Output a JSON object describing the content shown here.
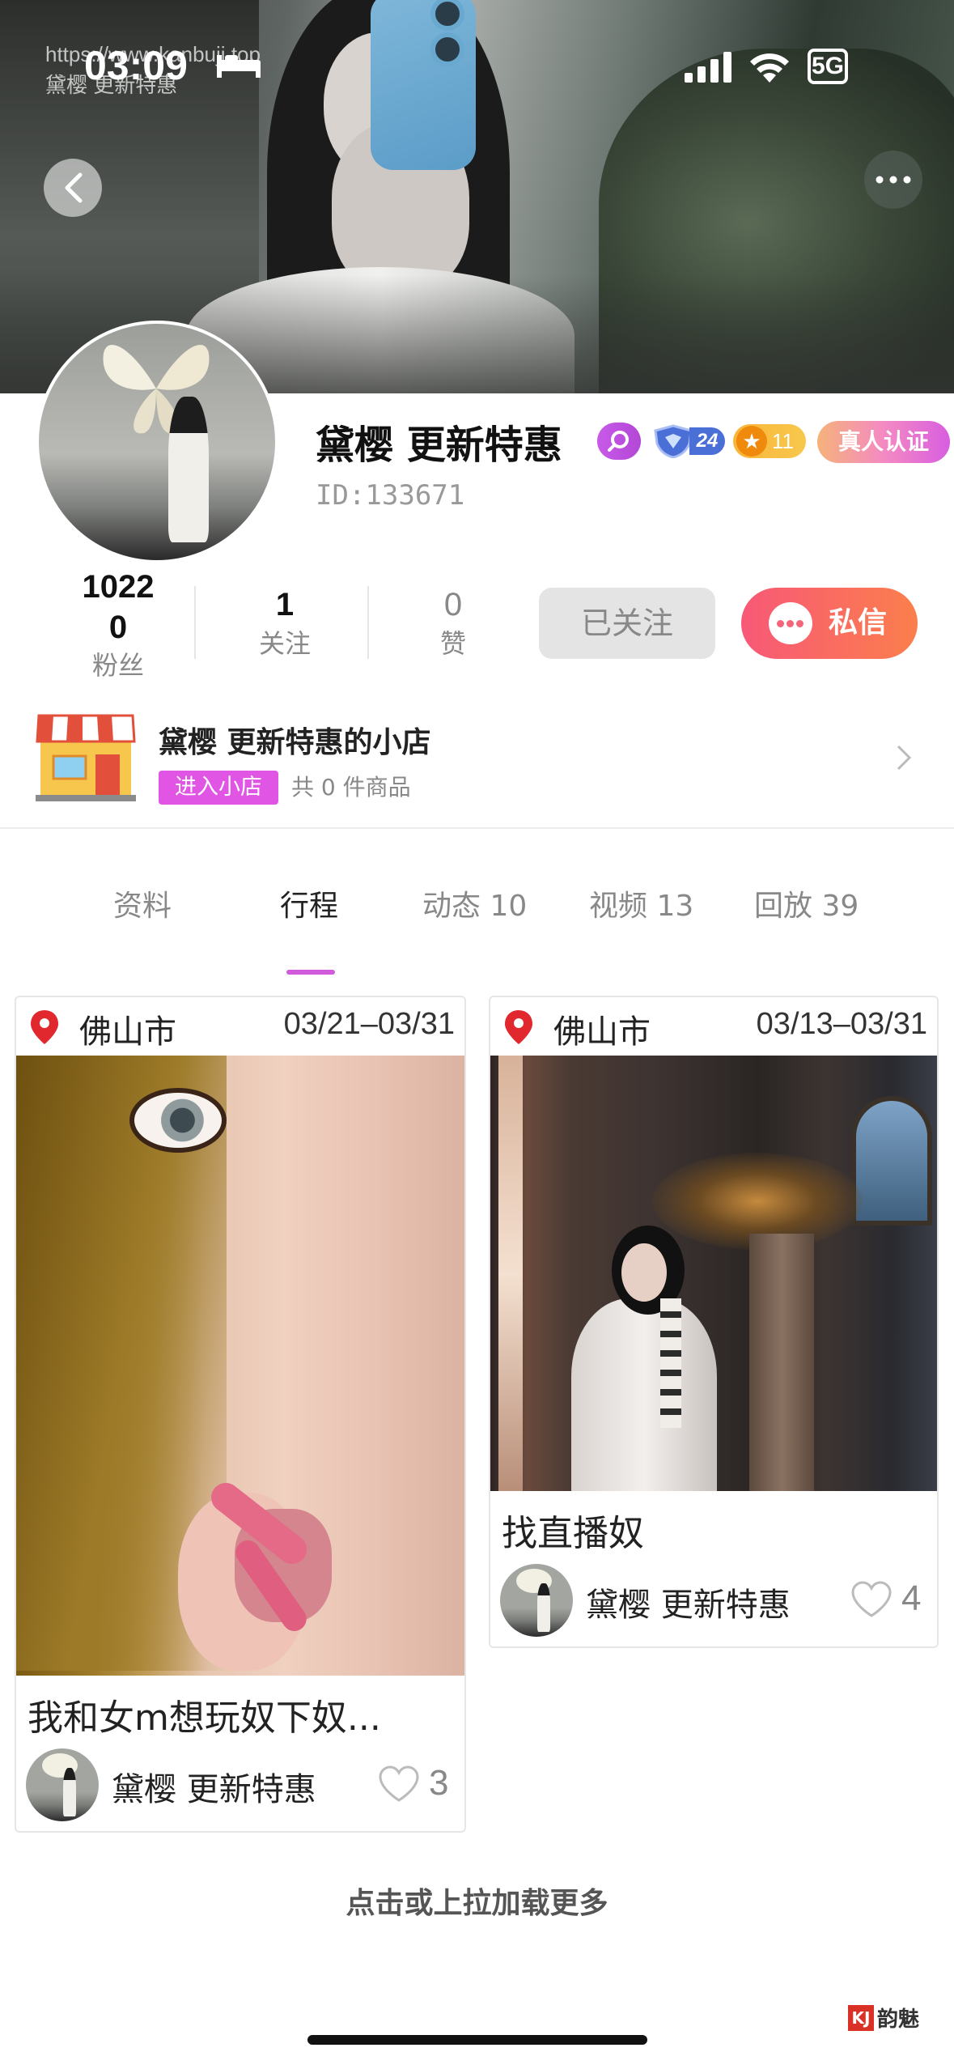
{
  "status_bar": {
    "time": "03:09",
    "network": "5G",
    "watermark": "https://www.kanbuji.top\n黛樱 更新特惠"
  },
  "profile": {
    "name": "黛樱 更新特惠",
    "vip_level": "24",
    "star_level": "11",
    "verified_label": "真人认证",
    "user_id": "ID:133671",
    "stats": {
      "fans_value": "1022\n0",
      "fans_label": "粉丝",
      "following_value": "1",
      "following_label": "关注",
      "likes_value": "0",
      "likes_label": "赞"
    },
    "followed_label": "已关注",
    "message_label": "私信"
  },
  "shop": {
    "title": "黛樱 更新特惠的小店",
    "enter_label": "进入小店",
    "goods_count": "共 0 件商品"
  },
  "tabs": [
    {
      "label": "资料",
      "active": false
    },
    {
      "label": "行程",
      "active": true
    },
    {
      "label": "动态 10",
      "active": false
    },
    {
      "label": "视频 13",
      "active": false
    },
    {
      "label": "回放 39",
      "active": false
    }
  ],
  "trips": [
    {
      "city": "佛山市",
      "dates": "03/21–03/31",
      "title": "我和女m想玩奴下奴...",
      "author": "黛樱 更新特惠",
      "likes": "3"
    },
    {
      "city": "佛山市",
      "dates": "03/13–03/31",
      "title": "找直播奴",
      "author": "黛樱 更新特惠",
      "likes": "4"
    }
  ],
  "load_more": "点击或上拉加载更多",
  "logo": {
    "mark": "KJ",
    "text": "韵魅"
  },
  "colors": {
    "accent_purple": "#d05cdc",
    "message_gradient": [
      "#f85877",
      "#fb7f4c"
    ],
    "location_pin": "#e0282e"
  }
}
